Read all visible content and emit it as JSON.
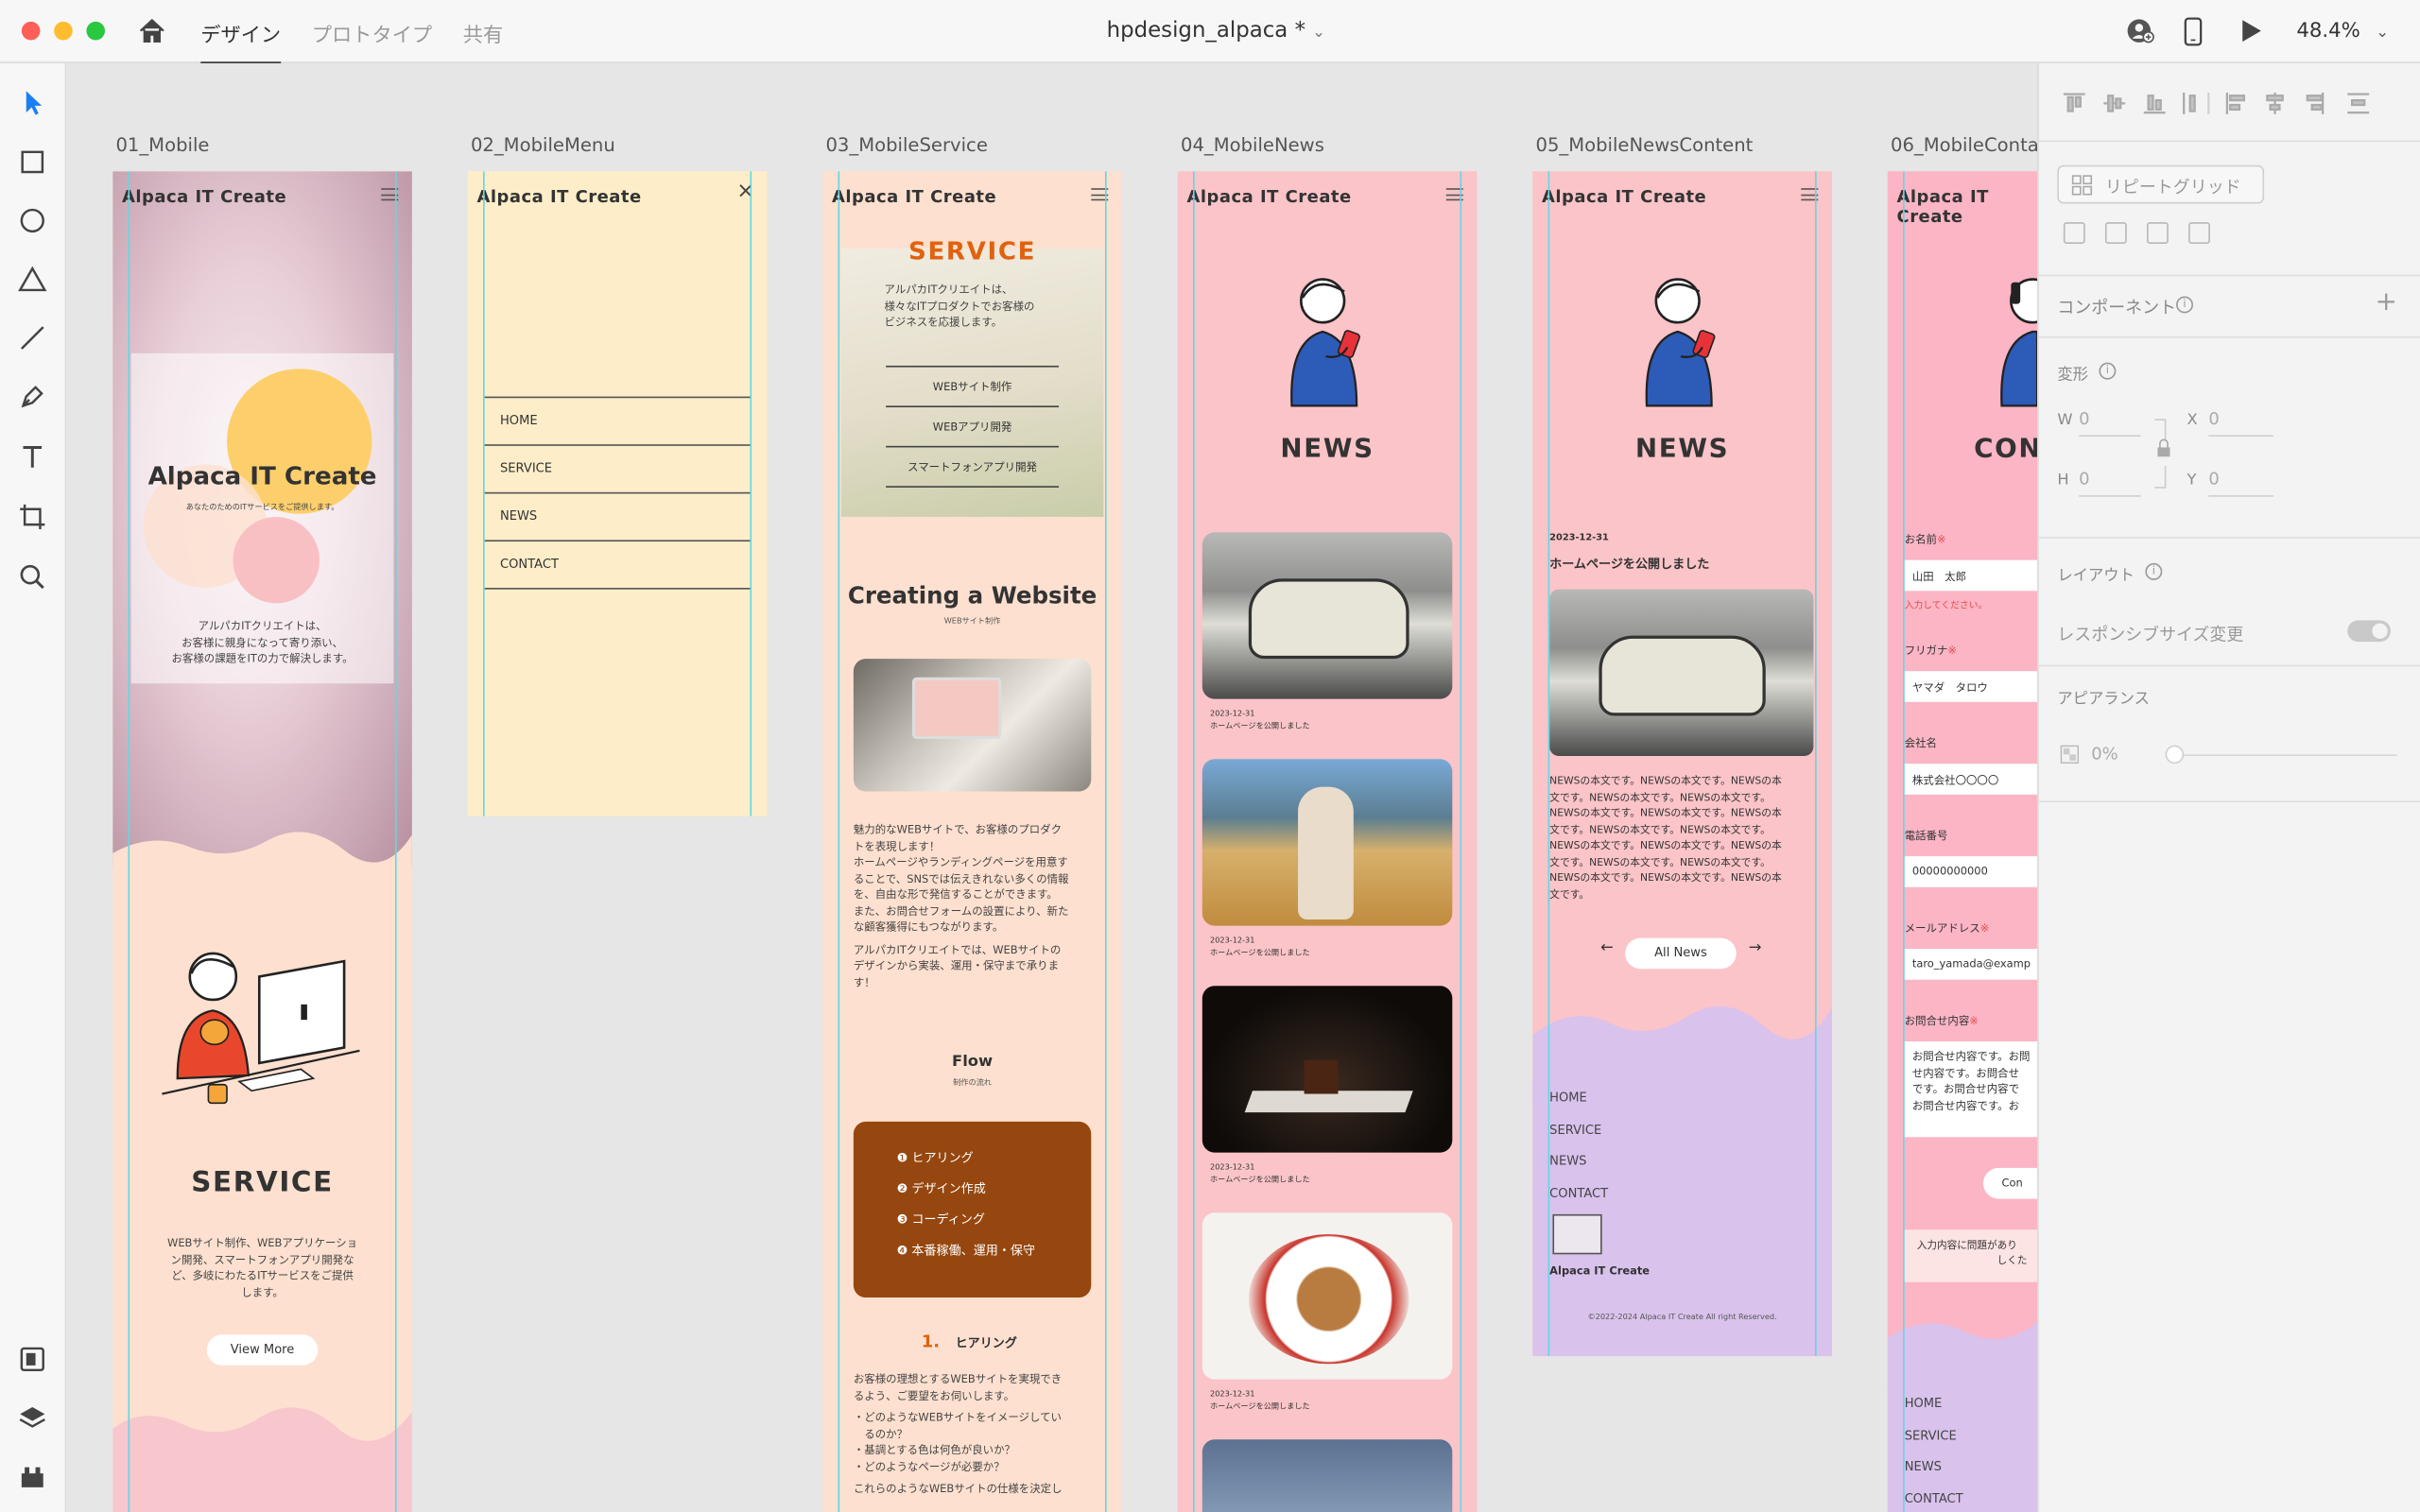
{
  "topbar": {
    "tabs": [
      {
        "label": "デザイン"
      },
      {
        "label": "プロトタイプ"
      },
      {
        "label": "共有"
      }
    ],
    "doc_title": "hpdesign_alpaca *",
    "zoom": "48.4%"
  },
  "colors": {
    "guide": "#5fd9e6",
    "pink": "#fbc4c8",
    "peach": "#fde0cf",
    "cream": "#fdeec9",
    "lavender": "#d9c2ec",
    "brown": "#96470f"
  },
  "artboards": {
    "a1": {
      "label": "01_Mobile",
      "logo": "Alpaca IT Create",
      "hero_title": "Alpaca IT Create",
      "hero_sub": "あなたのためのITサービスをご提供します。",
      "hero_text": [
        "アルパカITクリエイトは、",
        "お客様に親身になって寄り添い、",
        "お客様の課題をITの力で解決します。"
      ],
      "service_title": "SERVICE",
      "service_text": [
        "WEBサイト制作、WEBアプリケーショ",
        "ン開発、スマートフォンアプリ開発な",
        "ど、多岐にわたるITサービスをご提供",
        "します。"
      ],
      "button": "View More"
    },
    "a2": {
      "label": "02_MobileMenu",
      "logo": "Alpaca IT Create",
      "menu": [
        {
          "label": "HOME"
        },
        {
          "label": "SERVICE"
        },
        {
          "label": "NEWS"
        },
        {
          "label": "CONTACT"
        }
      ]
    },
    "a3": {
      "label": "03_MobileService",
      "logo": "Alpaca IT Create",
      "title": "SERVICE",
      "intro": [
        "アルパカITクリエイトは、",
        "様々なITプロダクトでお客様の",
        "ビジネスを応援します。"
      ],
      "links": [
        {
          "label": "WEBサイト制作"
        },
        {
          "label": "WEBアプリ開発"
        },
        {
          "label": "スマートフォンアプリ開発"
        }
      ],
      "section_title": "Creating a Website",
      "section_sub": "WEBサイト制作",
      "body1": [
        "魅力的なWEBサイトで、お客様のプロダク",
        "トを表現します！",
        "ホームページやランディングページを用意す",
        "ることで、SNSでは伝えきれない多くの情報",
        "を、自由な形で発信することができます。",
        "また、お問合せフォームの設置により、新た",
        "な顧客獲得にもつながります。"
      ],
      "body2": [
        "アルパカITクリエイトでは、WEBサイトの",
        "デザインから実装、運用・保守まで承りま",
        "す！"
      ],
      "flow_title": "Flow",
      "flow_sub": "制作の流れ",
      "flow": [
        {
          "label": "❶ ヒアリング"
        },
        {
          "label": "❷ デザイン作成"
        },
        {
          "label": "❸ コーディング"
        },
        {
          "label": "❹ 本番稼働、運用・保守"
        }
      ],
      "step_num": "1.",
      "step_title": "ヒアリング",
      "step_text": [
        "お客様の理想とするWEBサイトを実現でき",
        "るよう、ご要望をお伺いします。"
      ],
      "step_list": [
        "・どのようなWEBサイトをイメージしてい",
        "　るのか？",
        "・基調とする色は何色が良いか？",
        "・どのようなページが必要か？"
      ],
      "step_more": "これらのようなWEBサイトの仕様を決定し"
    },
    "a4": {
      "label": "04_MobileNews",
      "logo": "Alpaca IT Create",
      "title": "NEWS",
      "items": [
        {
          "date": "2023-12-31",
          "text": "ホームページを公開しました"
        },
        {
          "date": "2023-12-31",
          "text": "ホームページを公開しました"
        },
        {
          "date": "2023-12-31",
          "text": "ホームページを公開しました"
        },
        {
          "date": "2023-12-31",
          "text": "ホームページを公開しました"
        }
      ]
    },
    "a5": {
      "label": "05_MobileNewsContent",
      "logo": "Alpaca IT Create",
      "title": "NEWS",
      "date": "2023-12-31",
      "headline": "ホームページを公開しました",
      "body": [
        "NEWSの本文です。NEWSの本文です。NEWSの本",
        "文です。NEWSの本文です。NEWSの本文です。",
        "NEWSの本文です。NEWSの本文です。NEWSの本",
        "文です。NEWSの本文です。NEWSの本文です。",
        "NEWSの本文です。NEWSの本文です。NEWSの本",
        "文です。NEWSの本文です。NEWSの本文です。",
        "NEWSの本文です。NEWSの本文です。NEWSの本",
        "文です。"
      ],
      "button": "All News",
      "footer_nav": [
        {
          "label": "HOME"
        },
        {
          "label": "SERVICE"
        },
        {
          "label": "NEWS"
        },
        {
          "label": "CONTACT"
        }
      ],
      "footer_logo": "Alpaca IT Create",
      "copyright": "©2022-2024 Alpaca IT Create All right Reserved."
    },
    "a6": {
      "label": "06_MobileConta",
      "logo": "Alpaca IT Create",
      "title": "CON",
      "fields": [
        {
          "label": "お名前",
          "value": "山田　太郎"
        },
        {
          "label": "フリガナ",
          "value": "ヤマダ　タロウ"
        },
        {
          "label": "会社名",
          "value": "株式会社〇〇〇〇"
        },
        {
          "label": "電話番号",
          "value": "00000000000"
        },
        {
          "label": "メールアドレス",
          "value": "taro_yamada@examp"
        }
      ],
      "required_mark": "※",
      "error": "入力してください。",
      "message_label": "お問合せ内容",
      "message": [
        "お問合せ内容です。お問",
        "せ内容です。お問合せ",
        "です。お問合せ内容で",
        "お問合せ内容です。お"
      ],
      "confirm": "Con",
      "note": [
        "入力内容に問題があり",
        "しくた"
      ],
      "footer_nav": [
        {
          "label": "HOME"
        },
        {
          "label": "SERVICE"
        },
        {
          "label": "NEWS"
        },
        {
          "label": "CONTACT"
        }
      ]
    }
  },
  "panel": {
    "repeat_grid": "リピートグリッド",
    "component": "コンポーネント",
    "transform": "変形",
    "w_label": "W",
    "w_value": "0",
    "x_label": "X",
    "x_value": "0",
    "h_label": "H",
    "h_value": "0",
    "y_label": "Y",
    "y_value": "0",
    "layout": "レイアウト",
    "responsive": "レスポンシブサイズ変更",
    "appearance": "アピアランス",
    "opacity": "0%"
  }
}
